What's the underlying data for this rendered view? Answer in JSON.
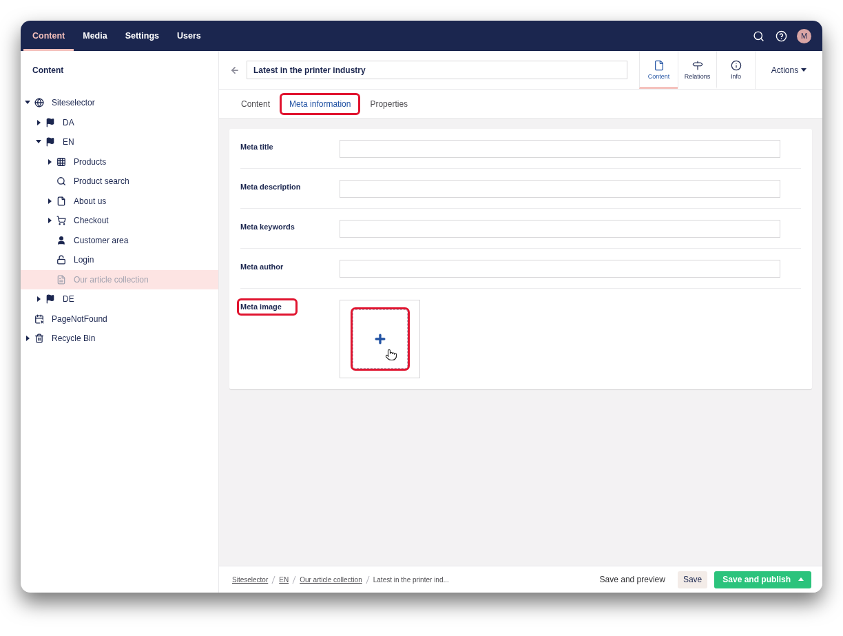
{
  "top_nav": [
    {
      "label": "Content",
      "selected": true
    },
    {
      "label": "Media",
      "selected": false
    },
    {
      "label": "Settings",
      "selected": false
    },
    {
      "label": "Users",
      "selected": false
    }
  ],
  "user_avatar": "M",
  "sidebar": {
    "title": "Content",
    "tree": [
      {
        "label": "Siteselector",
        "kind": "site",
        "expanded": true,
        "selected": false,
        "children": [
          {
            "label": "DA",
            "kind": "language",
            "expanded": false,
            "selected": false
          },
          {
            "label": "EN",
            "kind": "language",
            "expanded": true,
            "selected": false,
            "children": [
              {
                "label": "Products",
                "kind": "product-list",
                "expanded": false,
                "selected": false
              },
              {
                "label": "Product search",
                "kind": "search-page",
                "selected": false
              },
              {
                "label": "About us",
                "kind": "page",
                "expanded": false,
                "selected": false
              },
              {
                "label": "Checkout",
                "kind": "checkout",
                "expanded": false,
                "selected": false
              },
              {
                "label": "Customer area",
                "kind": "member-area",
                "selected": false
              },
              {
                "label": "Login",
                "kind": "login",
                "selected": false
              },
              {
                "label": "Our article collection",
                "kind": "article-list",
                "selected": true
              }
            ]
          },
          {
            "label": "DE",
            "kind": "language",
            "expanded": false,
            "selected": false
          }
        ]
      },
      {
        "label": "PageNotFound",
        "kind": "error-page",
        "selected": false
      },
      {
        "label": "Recycle Bin",
        "kind": "recycle-bin",
        "expanded": false,
        "selected": false
      }
    ]
  },
  "editor": {
    "name": "Latest in the printer industry",
    "apps": [
      {
        "label": "Content",
        "kind": "content",
        "selected": true
      },
      {
        "label": "Relations",
        "kind": "relations",
        "selected": false
      },
      {
        "label": "Info",
        "kind": "info",
        "selected": false
      }
    ],
    "actions": "Actions",
    "tabs": [
      {
        "label": "Content",
        "selected": false,
        "highlighted": false
      },
      {
        "label": "Meta information",
        "selected": true,
        "highlighted": true
      },
      {
        "label": "Properties",
        "selected": false,
        "highlighted": false
      }
    ],
    "properties": [
      {
        "label": "Meta title",
        "kind": "text",
        "highlighted": false
      },
      {
        "label": "Meta description",
        "kind": "text",
        "highlighted": false
      },
      {
        "label": "Meta keywords",
        "kind": "text",
        "highlighted": false
      },
      {
        "label": "Meta author",
        "kind": "text",
        "highlighted": false
      },
      {
        "label": "Meta image",
        "kind": "media",
        "highlighted": true,
        "add_highlighted": true
      }
    ]
  },
  "footer": {
    "breadcrumb": [
      {
        "label": "Siteselector",
        "link": true
      },
      {
        "label": "EN",
        "link": true
      },
      {
        "label": "Our article collection",
        "link": true
      },
      {
        "label": "Latest in the printer ind...",
        "link": false
      }
    ],
    "buttons": [
      {
        "label": "Save and preview",
        "kind": "link"
      },
      {
        "label": "Save",
        "kind": "secondary"
      },
      {
        "label": "Save and publish",
        "kind": "primary"
      }
    ]
  }
}
